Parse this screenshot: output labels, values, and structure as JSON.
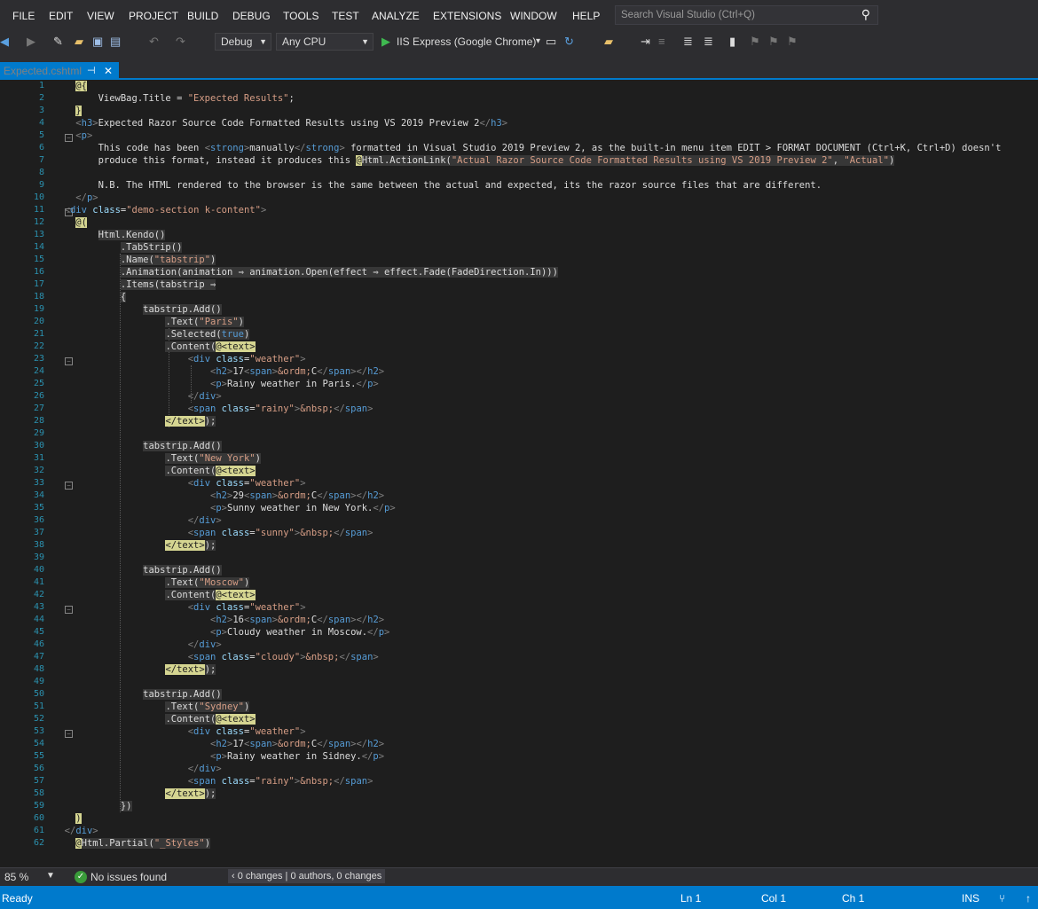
{
  "menu": {
    "items": [
      "FILE",
      "EDIT",
      "VIEW",
      "PROJECT",
      "BUILD",
      "DEBUG",
      "TOOLS",
      "TEST",
      "ANALYZE",
      "EXTENSIONS",
      "WINDOW",
      "HELP"
    ],
    "search_placeholder": "Search Visual Studio (Ctrl+Q)"
  },
  "toolbar": {
    "config": "Debug",
    "platform": "Any CPU",
    "run_target": "IIS Express (Google Chrome)"
  },
  "tab": {
    "title": "Expected.cshtml",
    "pin_glyph": "⊣",
    "close_glyph": "✕"
  },
  "editor": {
    "line_numbers": [
      "1",
      "2",
      "3",
      "4",
      "5",
      "6",
      "7",
      "8",
      "9",
      "10",
      "11",
      "12",
      "13",
      "14",
      "15",
      "16",
      "17",
      "18",
      "19",
      "20",
      "21",
      "22",
      "23",
      "24",
      "25",
      "26",
      "27",
      "28",
      "29",
      "30",
      "31",
      "32",
      "33",
      "34",
      "35",
      "36",
      "37",
      "38",
      "39",
      "40",
      "41",
      "42",
      "43",
      "44",
      "45",
      "46",
      "47",
      "48",
      "49",
      "50",
      "51",
      "52",
      "53",
      "54",
      "55",
      "56",
      "57",
      "58",
      "59",
      "60",
      "61",
      "62"
    ]
  },
  "status_strip": {
    "zoom": "85 %",
    "issues": "No issues found",
    "changes": "‹ 0 changes | 0 authors, 0 changes"
  },
  "status_bar": {
    "ready": "Ready",
    "ln": "Ln 1",
    "col": "Col 1",
    "ch": "Ch 1",
    "mode": "INS"
  }
}
